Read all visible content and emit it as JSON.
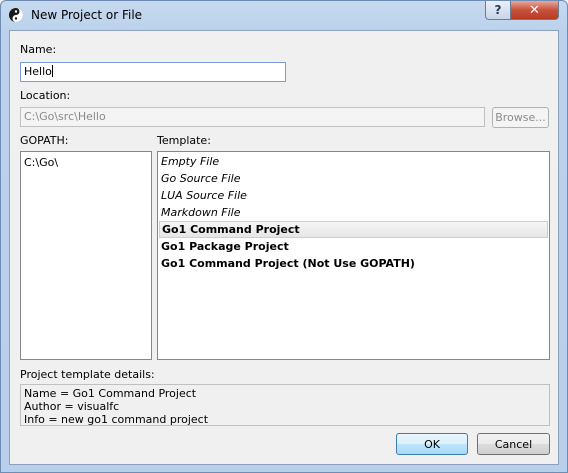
{
  "window": {
    "title": "New Project or File",
    "help_label": "?",
    "close_label": "✕"
  },
  "form": {
    "name_label": "Name:",
    "name_value": "Hello",
    "location_label": "Location:",
    "location_value": "C:\\Go\\src\\Hello",
    "browse_label": "Browse...",
    "gopath_label": "GOPATH:",
    "template_label": "Template:"
  },
  "gopath": {
    "items": [
      "C:\\Go\\"
    ]
  },
  "templates": {
    "items": [
      {
        "label": "Empty File",
        "style": "italic"
      },
      {
        "label": "Go Source File",
        "style": "italic"
      },
      {
        "label": "LUA Source File",
        "style": "italic"
      },
      {
        "label": "Markdown File",
        "style": "italic"
      },
      {
        "label": "Go1 Command Project",
        "style": "bold",
        "selected": true
      },
      {
        "label": "Go1 Package Project",
        "style": "bold"
      },
      {
        "label": "Go1 Command Project (Not Use GOPATH)",
        "style": "bold"
      }
    ]
  },
  "details": {
    "label": "Project template details:",
    "lines": [
      "Name = Go1 Command Project",
      "Author = visualfc",
      "Info = new go1 command project"
    ]
  },
  "buttons": {
    "ok_label": "OK",
    "cancel_label": "Cancel"
  }
}
